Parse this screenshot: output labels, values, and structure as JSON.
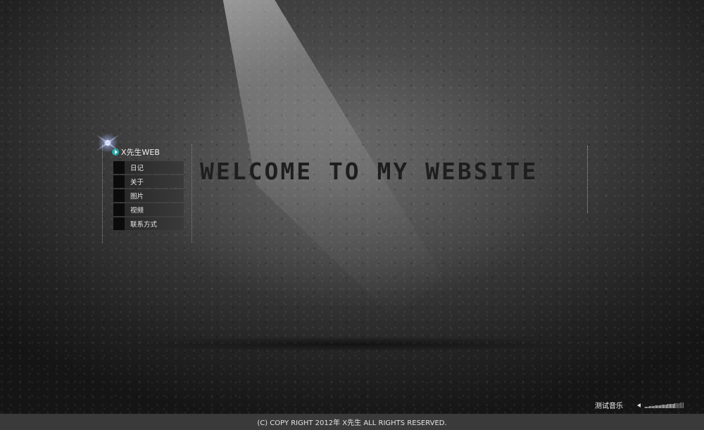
{
  "brand": {
    "title": "X先生WEB"
  },
  "menu": {
    "items": [
      {
        "label": "日记"
      },
      {
        "label": "关于"
      },
      {
        "label": "图片"
      },
      {
        "label": "视频"
      },
      {
        "label": "联系方式"
      }
    ]
  },
  "hero": {
    "headline": "WELCOME TO MY WEBSITE"
  },
  "music": {
    "label": "测试音乐",
    "volume": 0.78
  },
  "footer": {
    "copyright": "(C) COPY RIGHT 2012年 X先生 ALL RIGHTS RESERVED."
  },
  "colors": {
    "accent": "#2aa6a6",
    "footer_bg": "#3a3a3a"
  }
}
